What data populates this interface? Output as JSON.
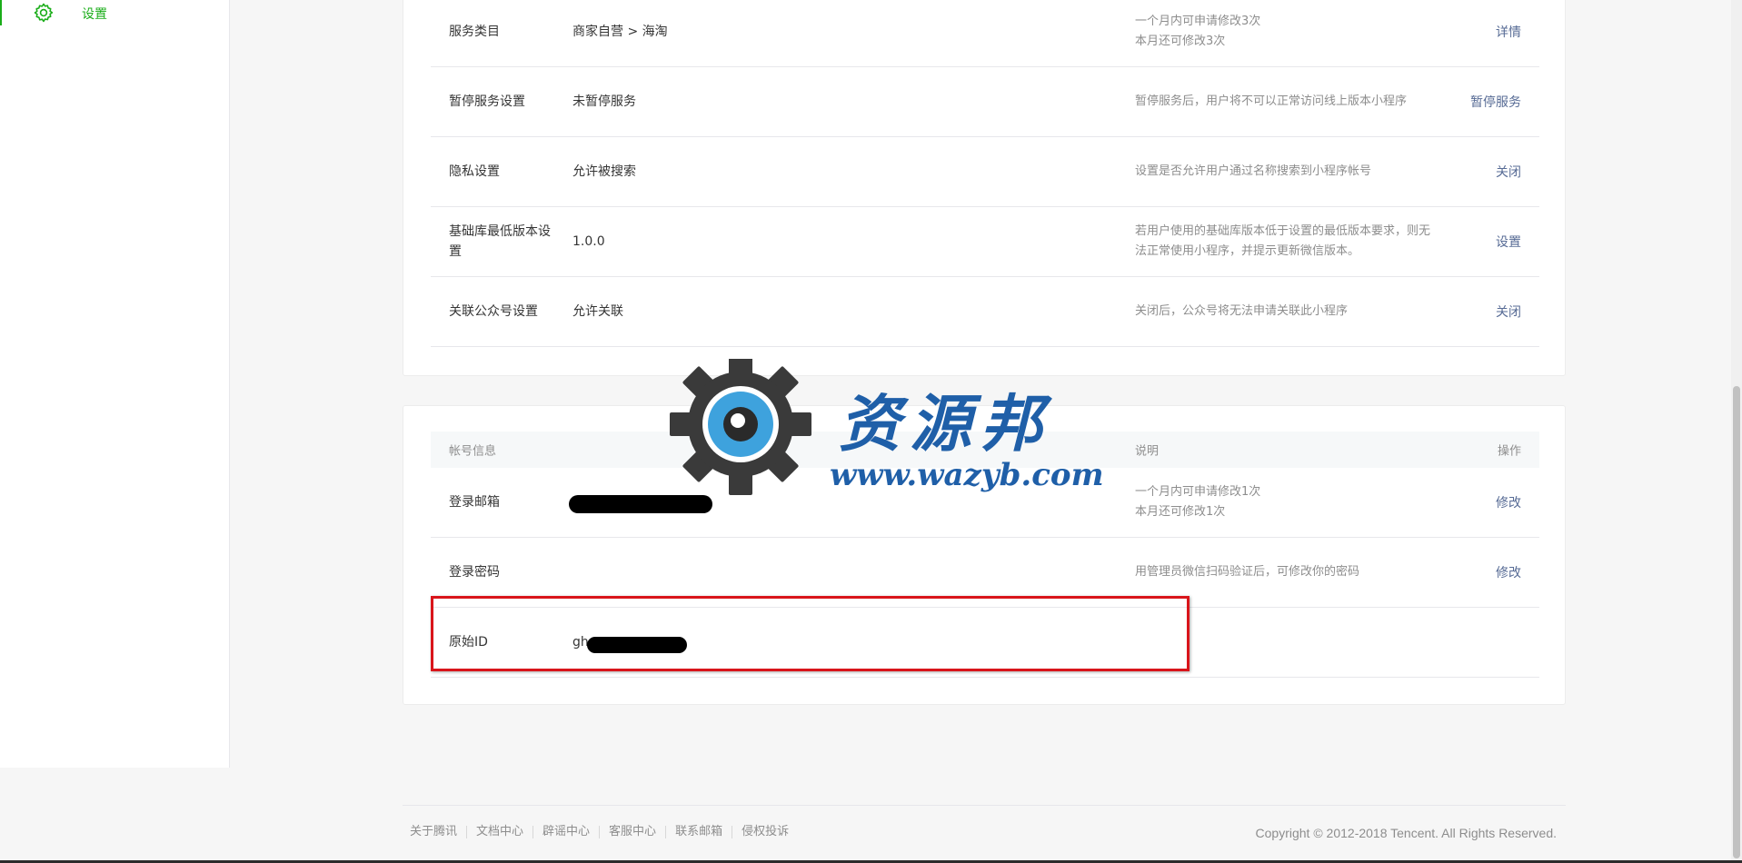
{
  "sidebar": {
    "items": [
      {
        "label": "设置",
        "icon": "gear-icon",
        "active": true
      }
    ]
  },
  "settings_card": {
    "rows": [
      {
        "name": "服务类目",
        "value": "商家自营 > 海淘",
        "desc": [
          "一个月内可申请修改3次",
          "本月还可修改3次"
        ],
        "action": "详情"
      },
      {
        "name": "暂停服务设置",
        "value": "未暂停服务",
        "desc": [
          "暂停服务后，用户将不可以正常访问线上版本小程序"
        ],
        "action": "暂停服务"
      },
      {
        "name": "隐私设置",
        "value": "允许被搜索",
        "desc": [
          "设置是否允许用户通过名称搜索到小程序帐号"
        ],
        "action": "关闭"
      },
      {
        "name": "基础库最低版本设置",
        "value": "1.0.0",
        "desc": [
          "若用户使用的基础库版本低于设置的最低版本要求，则无",
          "法正常使用小程序，并提示更新微信版本。"
        ],
        "action": "设置"
      },
      {
        "name": "关联公众号设置",
        "value": "允许关联",
        "desc": [
          "关闭后，公众号将无法申请关联此小程序"
        ],
        "action": "关闭"
      }
    ]
  },
  "account_card": {
    "header": {
      "col_name": "帐号信息",
      "col_desc": "说明",
      "col_action": "操作"
    },
    "rows": [
      {
        "name": "登录邮箱",
        "value": "",
        "desc": [
          "一个月内可申请修改1次",
          "本月还可修改1次"
        ],
        "action": "修改"
      },
      {
        "name": "登录密码",
        "value": "",
        "desc": [
          "用管理员微信扫码验证后，可修改你的密码"
        ],
        "action": "修改"
      },
      {
        "name": "原始ID",
        "value": "gh",
        "desc": [],
        "action": ""
      }
    ]
  },
  "watermark": {
    "title": "资源邦",
    "url": "www.wazyb.com"
  },
  "footer": {
    "links": [
      "关于腾讯",
      "文档中心",
      "辟谣中心",
      "客服中心",
      "联系邮箱",
      "侵权投诉"
    ],
    "copyright": "Copyright © 2012-2018 Tencent. All Rights Reserved."
  },
  "colors": {
    "accent": "#1aad19",
    "link": "#576b95",
    "highlight": "#d9151b",
    "watermark": "#1f5fa8"
  }
}
